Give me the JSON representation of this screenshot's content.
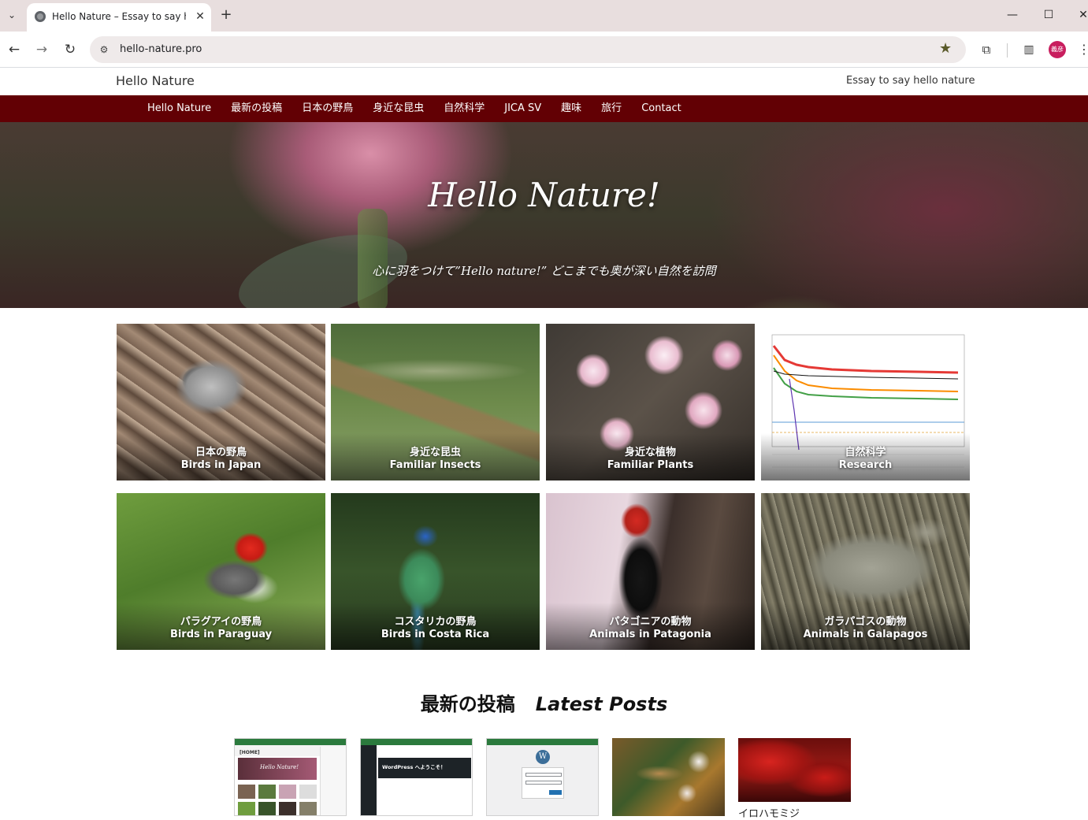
{
  "browser": {
    "tab_title": "Hello Nature – Essay to say hell",
    "url": "hello-nature.pro",
    "icons": {
      "tab_search": "chevron-down-icon",
      "close": "close-icon",
      "new_tab": "plus-icon",
      "back": "arrow-left-icon",
      "forward": "arrow-right-icon",
      "reload": "reload-icon",
      "site_info": "tune-icon",
      "bookmark": "star-icon",
      "extensions": "puzzle-icon",
      "side_panel": "side-panel-icon",
      "menu": "kebab-menu-icon"
    },
    "avatar_text": "義彦",
    "avatar_color": "#c81e5e"
  },
  "site": {
    "title": "Hello Nature",
    "tagline": "Essay to say hello nature",
    "nav_color": "#620004",
    "nav": [
      "Hello Nature",
      "最新の投稿",
      "日本の野鳥",
      "身近な昆虫",
      "自然科学",
      "JICA SV",
      "趣味",
      "旅行",
      "Contact"
    ]
  },
  "hero": {
    "title": "Hello Nature!",
    "subtitle": "心に羽をつけて”Hello nature!” どこまでも奥が深い自然を訪問"
  },
  "categories": [
    {
      "jp": "日本の野鳥",
      "en": "Birds in Japan"
    },
    {
      "jp": "身近な昆虫",
      "en": "Familiar Insects"
    },
    {
      "jp": "身近な植物",
      "en": "Familiar Plants"
    },
    {
      "jp": "自然科学",
      "en": "Research"
    },
    {
      "jp": "パラグアイの野鳥",
      "en": "Birds in Paraguay"
    },
    {
      "jp": "コスタリカの野鳥",
      "en": "Birds in Costa Rica"
    },
    {
      "jp": "パタゴニアの動物",
      "en": "Animals in Patagonia"
    },
    {
      "jp": "ガラパゴスの動物",
      "en": "Animals in Galapagos"
    }
  ],
  "latest": {
    "heading_jp": "最新の投稿",
    "heading_en": "Latest Posts",
    "posts": [
      {
        "thumb_text": "[HOME]",
        "thumb_sub": "Hello Nature!"
      },
      {
        "thumb_text": "WordPress へようこそ！"
      },
      {
        "thumb_text": "W"
      },
      {},
      {
        "label": "イロハモミジ"
      }
    ]
  }
}
